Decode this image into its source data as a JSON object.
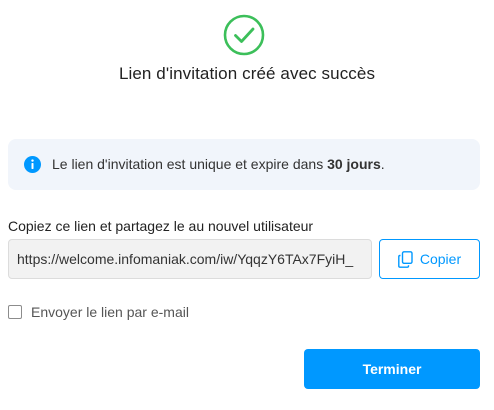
{
  "header": {
    "title": "Lien d'invitation créé avec succès",
    "icon": "check-circle-icon",
    "success_color": "#3cbf5a"
  },
  "info": {
    "icon": "info-icon",
    "text_prefix": "Le lien d'invitation est unique et expire dans ",
    "text_bold": "30 jours",
    "text_suffix": ".",
    "accent_color": "#0098ff"
  },
  "link": {
    "label": "Copiez ce lien et partagez le au nouvel utilisateur",
    "value": "https://welcome.infomaniak.com/iw/YqqzY6TAx7FyiH_"
  },
  "copy_button": {
    "label": "Copier",
    "icon": "copy-icon"
  },
  "email_option": {
    "label": "Envoyer le lien par e-mail",
    "checked": false
  },
  "finish_button": {
    "label": "Terminer"
  },
  "colors": {
    "primary": "#0098ff",
    "info_background": "#f1f5fb"
  }
}
